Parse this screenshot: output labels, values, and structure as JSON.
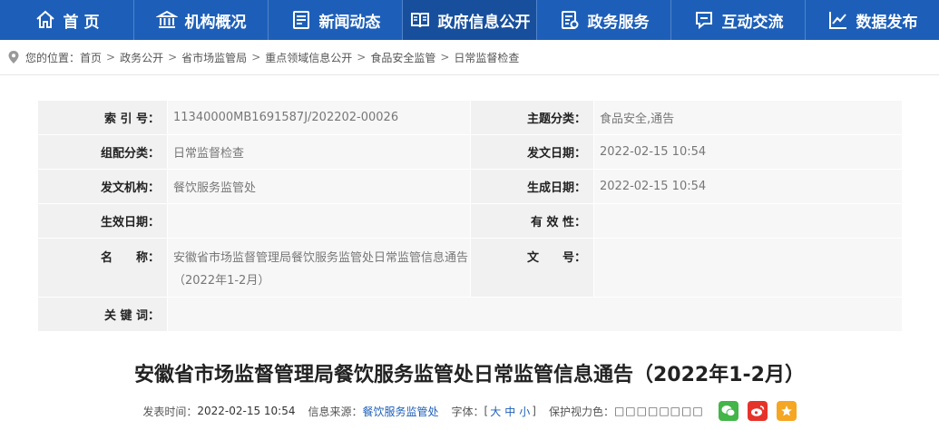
{
  "nav": {
    "items": [
      {
        "label": "首 页",
        "icon": "home-icon"
      },
      {
        "label": "机构概况",
        "icon": "institution-icon"
      },
      {
        "label": "新闻动态",
        "icon": "news-icon"
      },
      {
        "label": "政府信息公开",
        "icon": "book-icon"
      },
      {
        "label": "政务服务",
        "icon": "service-icon"
      },
      {
        "label": "互动交流",
        "icon": "chat-icon"
      },
      {
        "label": "数据发布",
        "icon": "chart-icon"
      }
    ]
  },
  "breadcrumb": {
    "prefix": "您的位置：",
    "items": [
      "首页",
      "政务公开",
      "省市场监管局",
      "重点领域信息公开",
      "食品安全监管",
      "日常监督检查"
    ],
    "separator": ">"
  },
  "info": {
    "index_label": "索 引 号：",
    "index_value": "11340000MB1691587J/202202-00026",
    "topic_label": "主题分类：",
    "topic_value": "食品安全,通告",
    "category_label": "组配分类：",
    "category_value": "日常监督检查",
    "issue_date_label": "发文日期：",
    "issue_date_value": "2022-02-15 10:54",
    "org_label": "发文机构：",
    "org_value": "餐饮服务监管处",
    "gen_date_label": "生成日期：",
    "gen_date_value": "2022-02-15 10:54",
    "effective_label": "生效日期：",
    "effective_value": "",
    "validity_label": "有 效 性：",
    "validity_value": "",
    "name_label": "名　　称：",
    "name_value": "安徽省市场监督管理局餐饮服务监管处日常监管信息通告（2022年1-2月）",
    "docno_label": "文　　号：",
    "docno_value": "",
    "keywords_label": "关 键 词：",
    "keywords_value": ""
  },
  "article": {
    "title": "安徽省市场监督管理局餐饮服务监管处日常监管信息通告（2022年1-2月）"
  },
  "meta": {
    "publish_label": "发表时间：",
    "publish_value": "2022-02-15 10:54",
    "source_label": "信息来源：",
    "source_value": "餐饮服务监管处",
    "font_label": "字体：",
    "font_open": "[",
    "font_large": "大",
    "font_medium": "中",
    "font_small": "小",
    "font_close": "]",
    "eye_label": "保护视力色：",
    "eye_boxes": "□□□□□□□□"
  },
  "colors": {
    "nav_bg": "#1d5fb8",
    "wechat": "#44b549",
    "weibo": "#e6332a",
    "favorite": "#f5a623"
  }
}
